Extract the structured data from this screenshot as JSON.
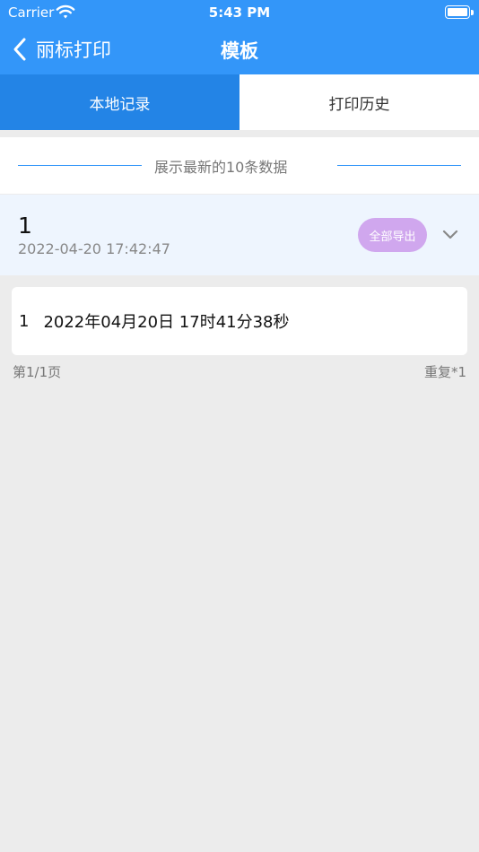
{
  "status_bar": {
    "carrier": "Carrier",
    "time": "5:43 PM"
  },
  "nav": {
    "back_label": "丽标打印",
    "title": "模板"
  },
  "tabs": [
    {
      "label": "本地记录",
      "active": true
    },
    {
      "label": "打印历史",
      "active": false
    }
  ],
  "info": {
    "text": "展示最新的10条数据"
  },
  "record": {
    "number": "1",
    "datetime": "2022-04-20 17:42:47",
    "export_label": "全部导出"
  },
  "items": [
    {
      "index": "1",
      "text": "2022年04月20日 17时41分38秒"
    }
  ],
  "footer": {
    "page": "第1/1页",
    "repeat": "重复*1"
  },
  "colors": {
    "primary": "#3396f9",
    "tab_active": "#2384e6",
    "export_button": "#d0a7ee",
    "record_bg": "#eef5fe",
    "page_bg": "#ececec"
  },
  "icons": [
    "wifi-icon",
    "battery-icon",
    "back-chevron-icon",
    "chevron-down-icon"
  ]
}
